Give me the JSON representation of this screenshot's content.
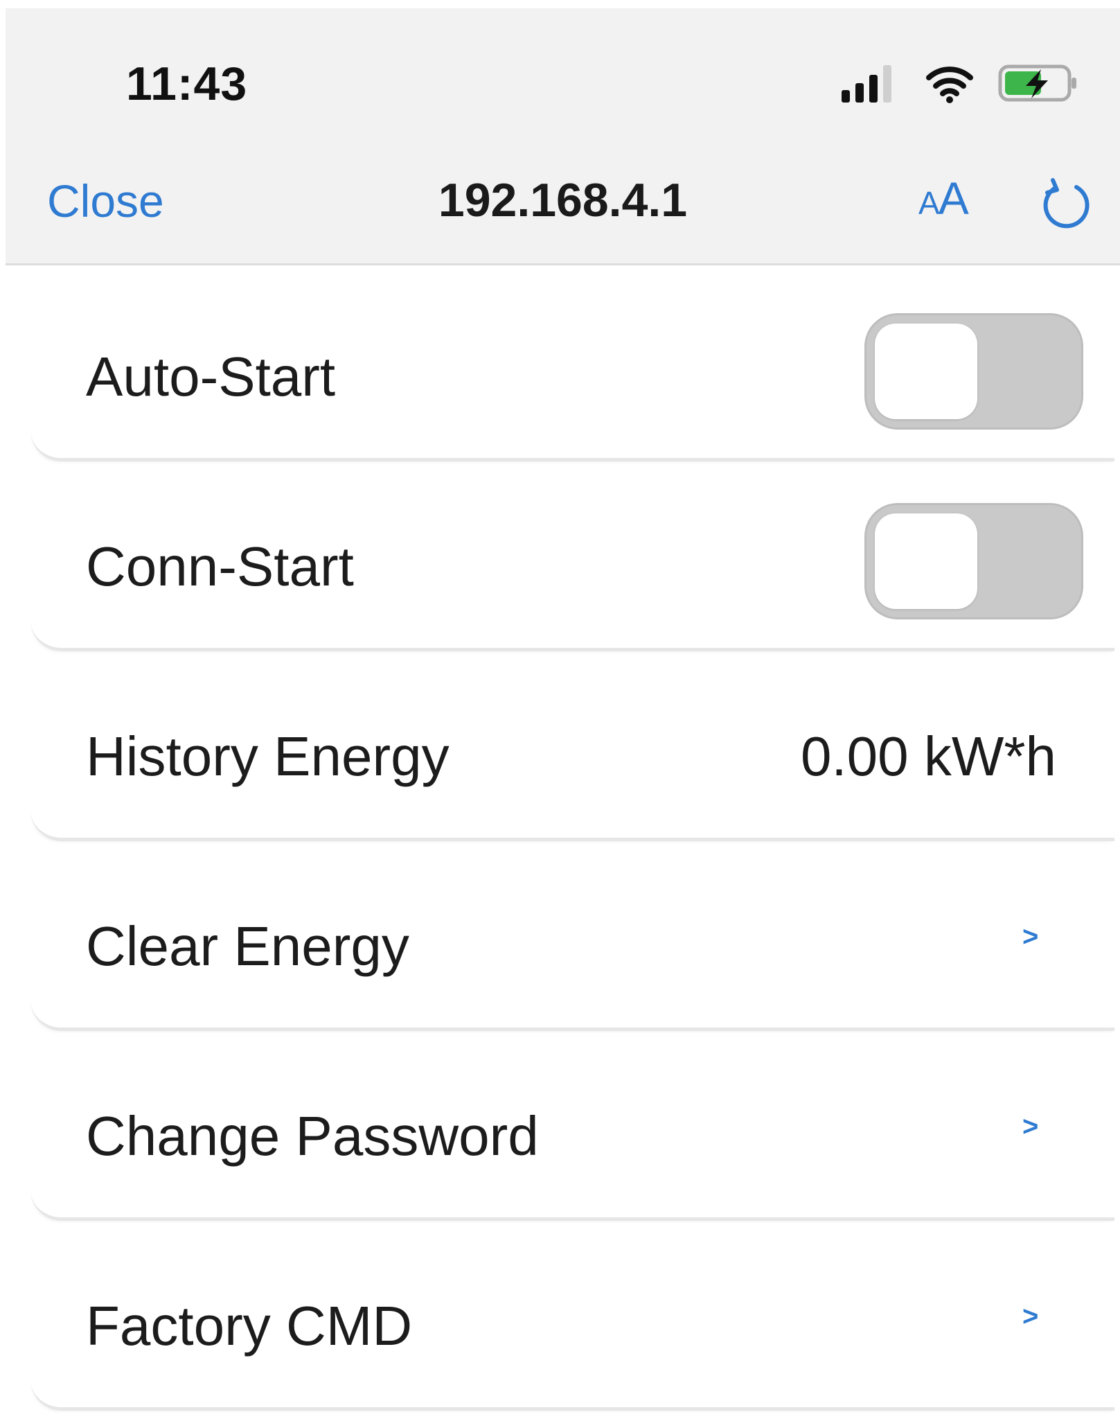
{
  "status_bar": {
    "time": "11:43",
    "icons": [
      "signal-icon",
      "wifi-icon",
      "battery-charging-icon"
    ],
    "battery_color": "#3db54a"
  },
  "browser_bar": {
    "close_label": "Close",
    "url": "192.168.4.1",
    "text_size_small": "A",
    "text_size_large": "A",
    "reload_icon": "reload-icon",
    "accent_color": "#2f7bd1"
  },
  "settings": {
    "auto_start": {
      "label": "Auto-Start",
      "enabled": false
    },
    "conn_start": {
      "label": "Conn-Start",
      "enabled": false
    },
    "history_energy": {
      "label": "History Energy",
      "value": "0.00 kW*h"
    },
    "clear_energy": {
      "label": "Clear Energy",
      "chevron": ">"
    },
    "change_password": {
      "label": "Change Password",
      "chevron": ">"
    },
    "factory_cmd": {
      "label": "Factory CMD",
      "chevron": ">"
    }
  }
}
